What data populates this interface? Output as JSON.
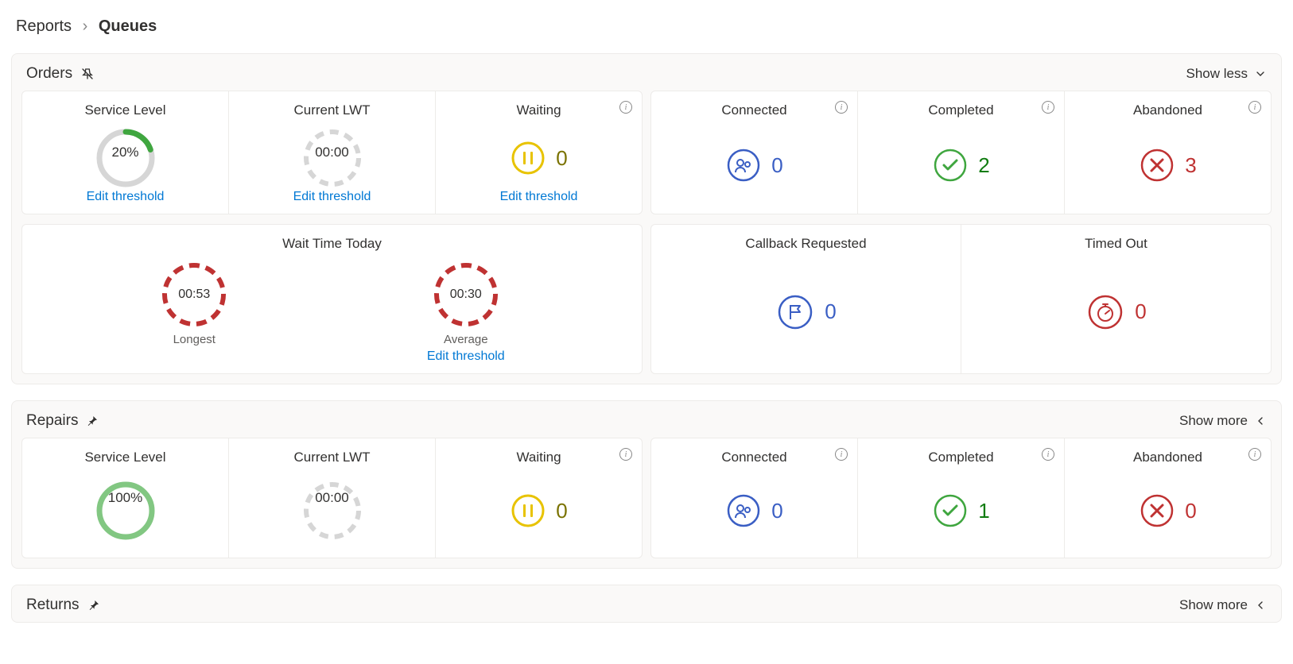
{
  "breadcrumb": {
    "parent": "Reports",
    "current": "Queues"
  },
  "common": {
    "edit_threshold": "Edit threshold",
    "show_less": "Show less",
    "show_more": "Show more"
  },
  "labels": {
    "service_level": "Service Level",
    "current_lwt": "Current LWT",
    "waiting": "Waiting",
    "connected": "Connected",
    "completed": "Completed",
    "abandoned": "Abandoned",
    "wait_time_today": "Wait Time Today",
    "longest": "Longest",
    "average": "Average",
    "callback_requested": "Callback Requested",
    "timed_out": "Timed Out"
  },
  "colors": {
    "blue": "#3a5ec4",
    "green": "#3fa63f",
    "dark_green": "#107c10",
    "yellow": "#e8c300",
    "red": "#bf3232",
    "grey_ring": "#d6d6d6",
    "green_ring": "#82c782",
    "link": "#0078d4"
  },
  "queues": {
    "orders": {
      "title": "Orders",
      "expanded": true,
      "service_level": {
        "value": "20%",
        "pct": 20
      },
      "current_lwt": "00:00",
      "waiting": "0",
      "connected": "0",
      "completed": "2",
      "abandoned": "3",
      "wait_time": {
        "longest": "00:53",
        "average": "00:30"
      },
      "callback_requested": "0",
      "timed_out": "0"
    },
    "repairs": {
      "title": "Repairs",
      "expanded": false,
      "service_level": {
        "value": "100%",
        "pct": 100
      },
      "current_lwt": "00:00",
      "waiting": "0",
      "connected": "0",
      "completed": "1",
      "abandoned": "0"
    },
    "returns": {
      "title": "Returns",
      "expanded": false
    }
  }
}
